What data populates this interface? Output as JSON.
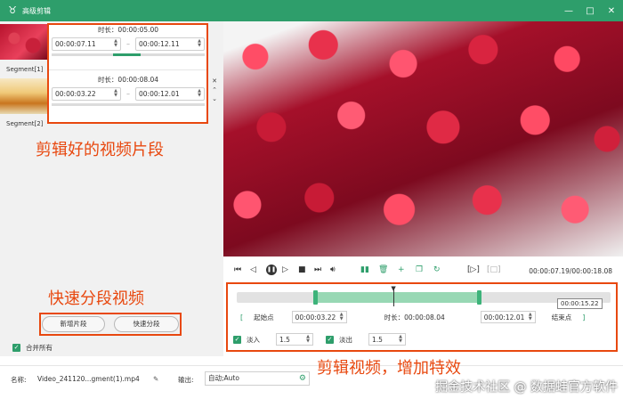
{
  "window": {
    "title": "高级剪辑",
    "controls": [
      "—",
      "□",
      "✕"
    ]
  },
  "segments_thumbs": [
    {
      "label": "Segment[1]"
    },
    {
      "label": "Segment[2]"
    }
  ],
  "segment_list": [
    {
      "duration": "时长：00:00:05.00",
      "start": "00:00:07.11",
      "end": "00:00:12.11"
    },
    {
      "duration": "时长：00:00:08.04",
      "start": "00:00:03.22",
      "end": "00:00:12.01"
    }
  ],
  "list_side_controls": {
    "close": "✕",
    "up": "⌃",
    "down": "⌄"
  },
  "annotations": {
    "clipped_segments": "剪辑好的视频片段",
    "quick_split": "快速分段视频",
    "edit_effects": "剪辑视频，增加特效"
  },
  "buttons": {
    "add_segment": "新增片段",
    "quick_split": "快速分段"
  },
  "merge_all": {
    "label": "合并所有",
    "checked": true
  },
  "player": {
    "timecode": "00:00:07.19/00:00:18.08"
  },
  "timeline": {
    "tooltip": "00:00:15.22",
    "selection_start_fraction": 0.21,
    "selection_end_fraction": 0.65,
    "playhead_fraction": 0.42
  },
  "range": {
    "start_bracket": "[",
    "start_label": "起始点",
    "start_value": "00:00:03.22",
    "duration_label": "时长：00:00:08.04",
    "end_value": "00:00:12.01",
    "end_label": "结束点",
    "end_bracket": "]"
  },
  "effects": {
    "fade_in_label": "淡入",
    "fade_in_value": "1.5",
    "fade_out_label": "淡出",
    "fade_out_value": "1.5"
  },
  "bottom": {
    "name_label": "名称:",
    "name_value": "Video_241120...gment(1).mp4",
    "output_label": "输出:",
    "output_value": "自动;Auto"
  },
  "watermark": "掘金技术社区 @ 数据蛙官方软件",
  "colors": {
    "accent": "#2e9e6b",
    "annotation": "#e8480f"
  }
}
